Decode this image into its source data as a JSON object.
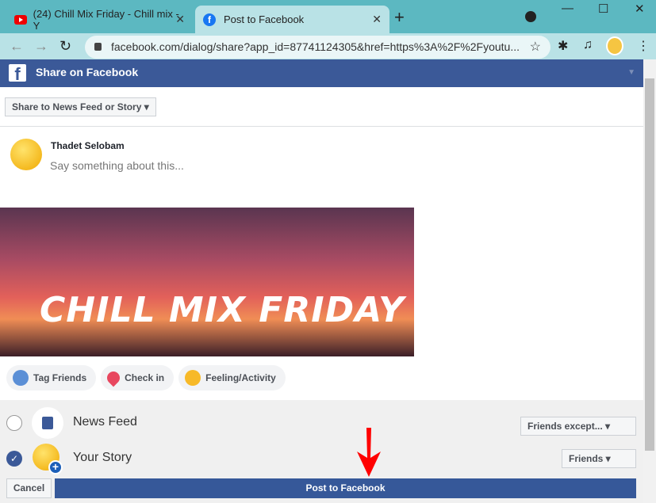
{
  "browser": {
    "tabs": [
      {
        "title": "(24) Chill Mix Friday - Chill mix - Y",
        "icon": "youtube-icon"
      },
      {
        "title": "Post to Facebook",
        "icon": "facebook-icon",
        "active": true
      }
    ],
    "url": "facebook.com/dialog/share?app_id=87741124305&href=https%3A%2F%2Fyoutu..."
  },
  "dialog": {
    "header": "Share on Facebook",
    "share_target": "Share to News Feed or Story ▾",
    "user_name": "Thadet Selobam",
    "composer_placeholder": "Say something about this...",
    "preview_text": "CHILL MIX FRIDAY",
    "actions": [
      {
        "label": "Tag Friends",
        "icon": "tag-friends-icon"
      },
      {
        "label": "Check in",
        "icon": "location-pin-icon"
      },
      {
        "label": "Feeling/Activity",
        "icon": "smiley-icon"
      }
    ],
    "destinations": [
      {
        "label": "News Feed",
        "checked": false,
        "audience": "Friends except... ▾"
      },
      {
        "label": "Your Story",
        "checked": true,
        "audience": "Friends ▾"
      }
    ],
    "cancel": "Cancel",
    "post": "Post to Facebook"
  },
  "colors": {
    "facebook_blue": "#3b5998",
    "annotation_arrow": "#ff0000",
    "tab_bar": "#5cb8c1"
  }
}
